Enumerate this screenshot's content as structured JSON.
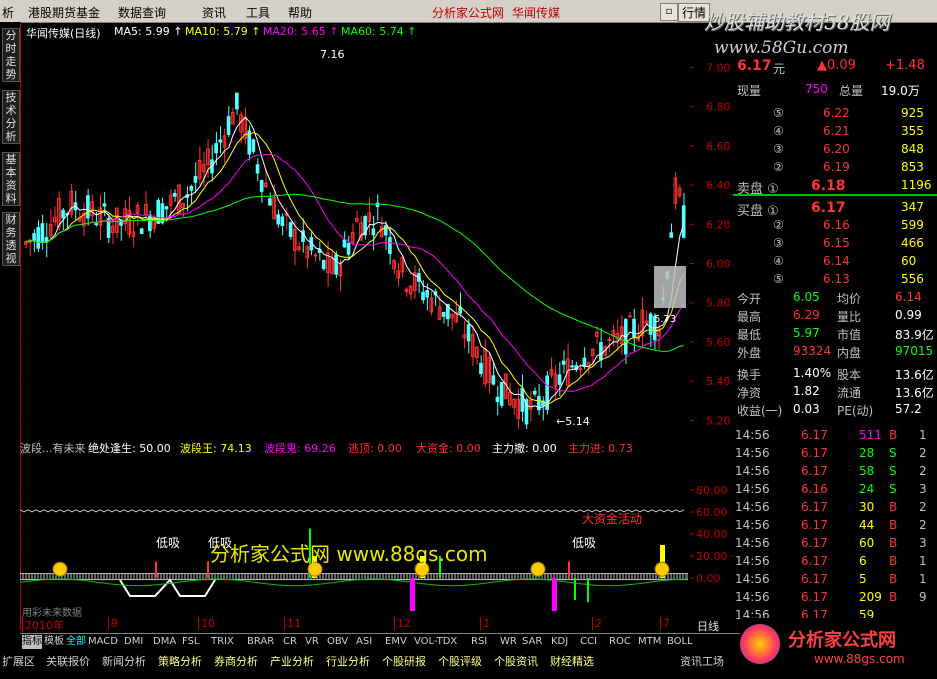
{
  "menu": {
    "items": [
      "析",
      "港股期货基金",
      "数据查询",
      "资讯",
      "工具",
      "帮助"
    ],
    "title": "分析家公式网",
    "stock": "华闻传媒",
    "right_btn": "行情"
  },
  "watermark": {
    "line1": "炒股辅助教材58股网",
    "line2": "www.58Gu.com"
  },
  "sidetabs": [
    "分时走势",
    "技术分析",
    "基本资料",
    "财务透视"
  ],
  "chart": {
    "legend": [
      {
        "label": "华闻传媒(日线)",
        "color": "#ffffff"
      },
      {
        "label": "MA5: 5.99",
        "color": "#ffffff"
      },
      {
        "label": "MA10: 5.79",
        "color": "#ffff00"
      },
      {
        "label": "MA20: 5.65",
        "color": "#ff00ff"
      },
      {
        "label": "MA60: 5.74",
        "color": "#00ff00"
      }
    ],
    "y_ticks": [
      "7.00",
      "6.80",
      "6.60",
      "6.40",
      "6.20",
      "6.00",
      "5.80",
      "5.60",
      "5.40",
      "5.20"
    ],
    "high_label": "7.16",
    "low_label": "5.14",
    "right_label": "5.73"
  },
  "indicator": {
    "labels": [
      {
        "label": "波段...有未来",
        "color": "#c0c0c0"
      },
      {
        "label": "绝处逢生: 50.00",
        "color": "#ffffff"
      },
      {
        "label": "波段王: 74.13",
        "color": "#ffff00"
      },
      {
        "label": "波段鬼: 69.26",
        "color": "#ff00ff"
      },
      {
        "label": "逃顶: 0.00",
        "color": "#ff3030"
      },
      {
        "label": "大资金: 0.00",
        "color": "#ff3030"
      },
      {
        "label": "主力撤: 0.00",
        "color": "#ffffff"
      },
      {
        "label": "主力进: 0.73",
        "color": "#ff3030"
      }
    ],
    "y_ticks": [
      "80.00",
      "60.00",
      "40.00",
      "20.00",
      "0.00"
    ],
    "annotations": [
      "低吸",
      "低吸",
      "低吸",
      "大资金活动"
    ],
    "site": "分析家公式网 www.88gs.com",
    "footer": "用彩未来数据"
  },
  "xaxis": [
    "2010年",
    "9",
    "10",
    "11",
    "12",
    "1",
    "2",
    "7"
  ],
  "right_panel": {
    "price": "6.17",
    "unit": "元",
    "change": "▲0.09",
    "pct": "+1.48",
    "xianliang_label": "现量",
    "xianliang": "750",
    "zongliang_label": "总量",
    "zongliang": "19.0万",
    "sells": [
      [
        "⑤",
        "6.22",
        "925"
      ],
      [
        "④",
        "6.21",
        "355"
      ],
      [
        "③",
        "6.20",
        "848"
      ],
      [
        "②",
        "6.19",
        "853"
      ],
      [
        "卖盘 ①",
        "6.18",
        "1196"
      ]
    ],
    "buys": [
      [
        "买盘 ①",
        "6.17",
        "347"
      ],
      [
        "②",
        "6.16",
        "599"
      ],
      [
        "③",
        "6.15",
        "466"
      ],
      [
        "④",
        "6.14",
        "60"
      ],
      [
        "⑤",
        "6.13",
        "556"
      ]
    ],
    "stats": [
      [
        "今开",
        "6.05",
        "均价",
        "6.14"
      ],
      [
        "最高",
        "6.29",
        "量比",
        "0.99"
      ],
      [
        "最低",
        "5.97",
        "市值",
        "83.9亿"
      ],
      [
        "外盘",
        "93324",
        "内盘",
        "97015"
      ],
      [
        "换手",
        "1.40%",
        "股本",
        "13.6亿"
      ],
      [
        "净资",
        "1.82",
        "流通",
        "13.6亿"
      ],
      [
        "收益(一)",
        "0.03",
        "PE(动)",
        "57.2"
      ]
    ],
    "ticks": [
      [
        "14:56",
        "6.17",
        "511",
        "B",
        "1"
      ],
      [
        "14:56",
        "6.17",
        "28",
        "S",
        "2"
      ],
      [
        "14:56",
        "6.17",
        "58",
        "S",
        "2"
      ],
      [
        "14:56",
        "6.16",
        "24",
        "S",
        "3"
      ],
      [
        "14:56",
        "6.17",
        "30",
        "B",
        "2"
      ],
      [
        "14:56",
        "6.17",
        "44",
        "B",
        "2"
      ],
      [
        "14:56",
        "6.17",
        "60",
        "B",
        "3"
      ],
      [
        "14:56",
        "6.17",
        "6",
        "B",
        "1"
      ],
      [
        "14:56",
        "6.17",
        "5",
        "B",
        "1"
      ],
      [
        "14:56",
        "6.17",
        "209",
        "B",
        "9"
      ],
      [
        "14:56",
        "6.17",
        "59",
        "",
        ""
      ]
    ],
    "period": "日线"
  },
  "bottom_tabs": [
    "指标",
    "模板",
    "全部",
    "MACD",
    "DMI",
    "DMA",
    "FSL",
    "TRIX",
    "BRAR",
    "CR",
    "VR",
    "OBV",
    "ASI",
    "EMV",
    "VOL-TDX",
    "RSI",
    "WR",
    "SAR",
    "KDJ",
    "CCI",
    "ROC",
    "MTM",
    "BOLL"
  ],
  "bottom_bar": [
    "扩展区",
    "关联报价",
    "新闻分析",
    "策略分析",
    "券商分析",
    "产业分析",
    "行业分析",
    "个股研报",
    "个股评级",
    "个股资讯",
    "财经精选",
    "资讯工场"
  ],
  "logo": {
    "text": "分析家公式网",
    "url": "www.88gs.com"
  }
}
